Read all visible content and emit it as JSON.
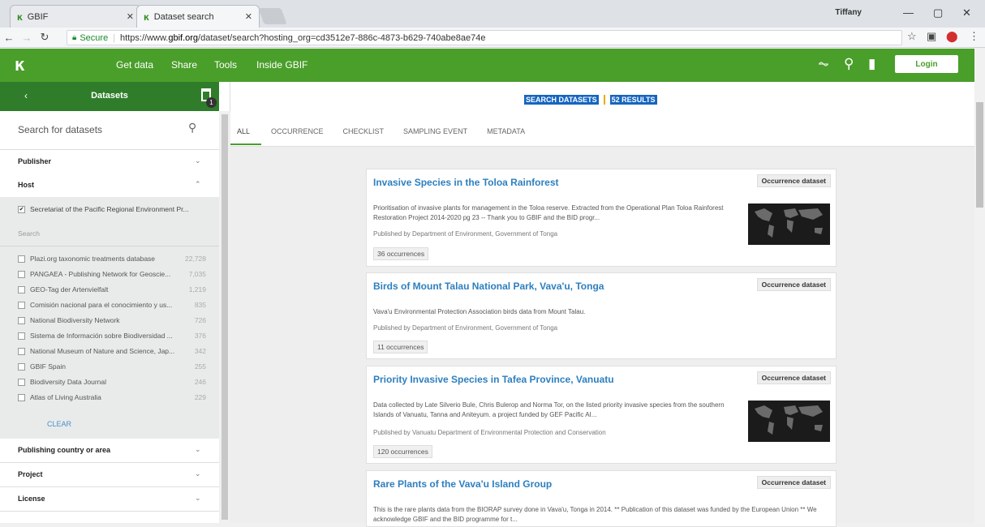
{
  "browser": {
    "tabs": [
      {
        "title": "GBIF",
        "active": false
      },
      {
        "title": "Dataset search",
        "active": true
      }
    ],
    "user": "Tiffany",
    "secure_label": "Secure",
    "url_prefix": "https://www.",
    "url_host": "gbif.org",
    "url_path": "/dataset/search?hosting_org=cd3512e7-886c-4873-b629-740abe8ae74e"
  },
  "header": {
    "nav": [
      "Get data",
      "Share",
      "Tools",
      "Inside GBIF"
    ],
    "login_label": "Login",
    "brand_color": "#4a9e2a"
  },
  "sidebar": {
    "title": "Datasets",
    "filter_count": "1",
    "search_placeholder": "Search for datasets",
    "facets": {
      "publisher": "Publisher",
      "host": "Host",
      "publishing_country": "Publishing country or area",
      "project": "Project",
      "license": "License"
    },
    "host": {
      "selected": "Secretariat of the Pacific Regional Environment Pr...",
      "search_label": "Search",
      "options": [
        {
          "name": "Plazi.org taxonomic treatments database",
          "count": "22,728"
        },
        {
          "name": "PANGAEA - Publishing Network for Geoscie...",
          "count": "7,035"
        },
        {
          "name": "GEO-Tag der Artenvielfalt",
          "count": "1,219"
        },
        {
          "name": "Comisión nacional para el conocimiento y us...",
          "count": "835"
        },
        {
          "name": "National Biodiversity Network",
          "count": "726"
        },
        {
          "name": "Sistema de Información sobre Biodiversidad ...",
          "count": "376"
        },
        {
          "name": "National Museum of Nature and Science, Jap...",
          "count": "342"
        },
        {
          "name": "GBIF Spain",
          "count": "255"
        },
        {
          "name": "Biodiversity Data Journal",
          "count": "246"
        },
        {
          "name": "Atlas of Living Australia",
          "count": "229"
        }
      ],
      "clear_label": "CLEAR"
    }
  },
  "main": {
    "search_label": "SEARCH DATASETS",
    "results_label": "52 RESULTS",
    "tabs": [
      "ALL",
      "OCCURRENCE",
      "CHECKLIST",
      "SAMPLING EVENT",
      "METADATA"
    ],
    "results": [
      {
        "title": "Invasive Species in the Toloa Rainforest",
        "type": "Occurrence dataset",
        "description": "Prioritisation of invasive plants for management in the Toloa reserve. Extracted from the Operational Plan Toloa Rainforest Restoration Project 2014-2020 pg 23 -- Thank you to GBIF and the BID progr...",
        "publisher": "Published by Department of Environment, Government of Tonga",
        "occurrences": "36 occurrences"
      },
      {
        "title": "Birds of Mount Talau National Park, Vava'u, Tonga",
        "type": "Occurrence dataset",
        "description": "Vava'u Environmental Protection Association birds data from Mount Talau.",
        "publisher": "Published by Department of Environment, Government of Tonga",
        "occurrences": "11 occurrences"
      },
      {
        "title": "Priority Invasive Species in Tafea Province, Vanuatu",
        "type": "Occurrence dataset",
        "description": "Data collected by Late Silverio Bule, Chris Bulerop and Norma Tor, on the listed priority invasive species from the southern Islands of Vanuatu, Tanna and Aniteyum. a project funded by GEF Pacific AI...",
        "publisher": "Published by Vanuatu Department of Environmental Protection and Conservation",
        "occurrences": "120 occurrences"
      },
      {
        "title": "Rare Plants of the Vava'u Island Group",
        "type": "Occurrence dataset",
        "description": "This is the rare plants data from the BIORAP survey done in Vava'u, Tonga in 2014. ** Publication of this dataset was funded by the European Union ** We acknowledge GBIF and the BID programme for t..."
      }
    ]
  }
}
